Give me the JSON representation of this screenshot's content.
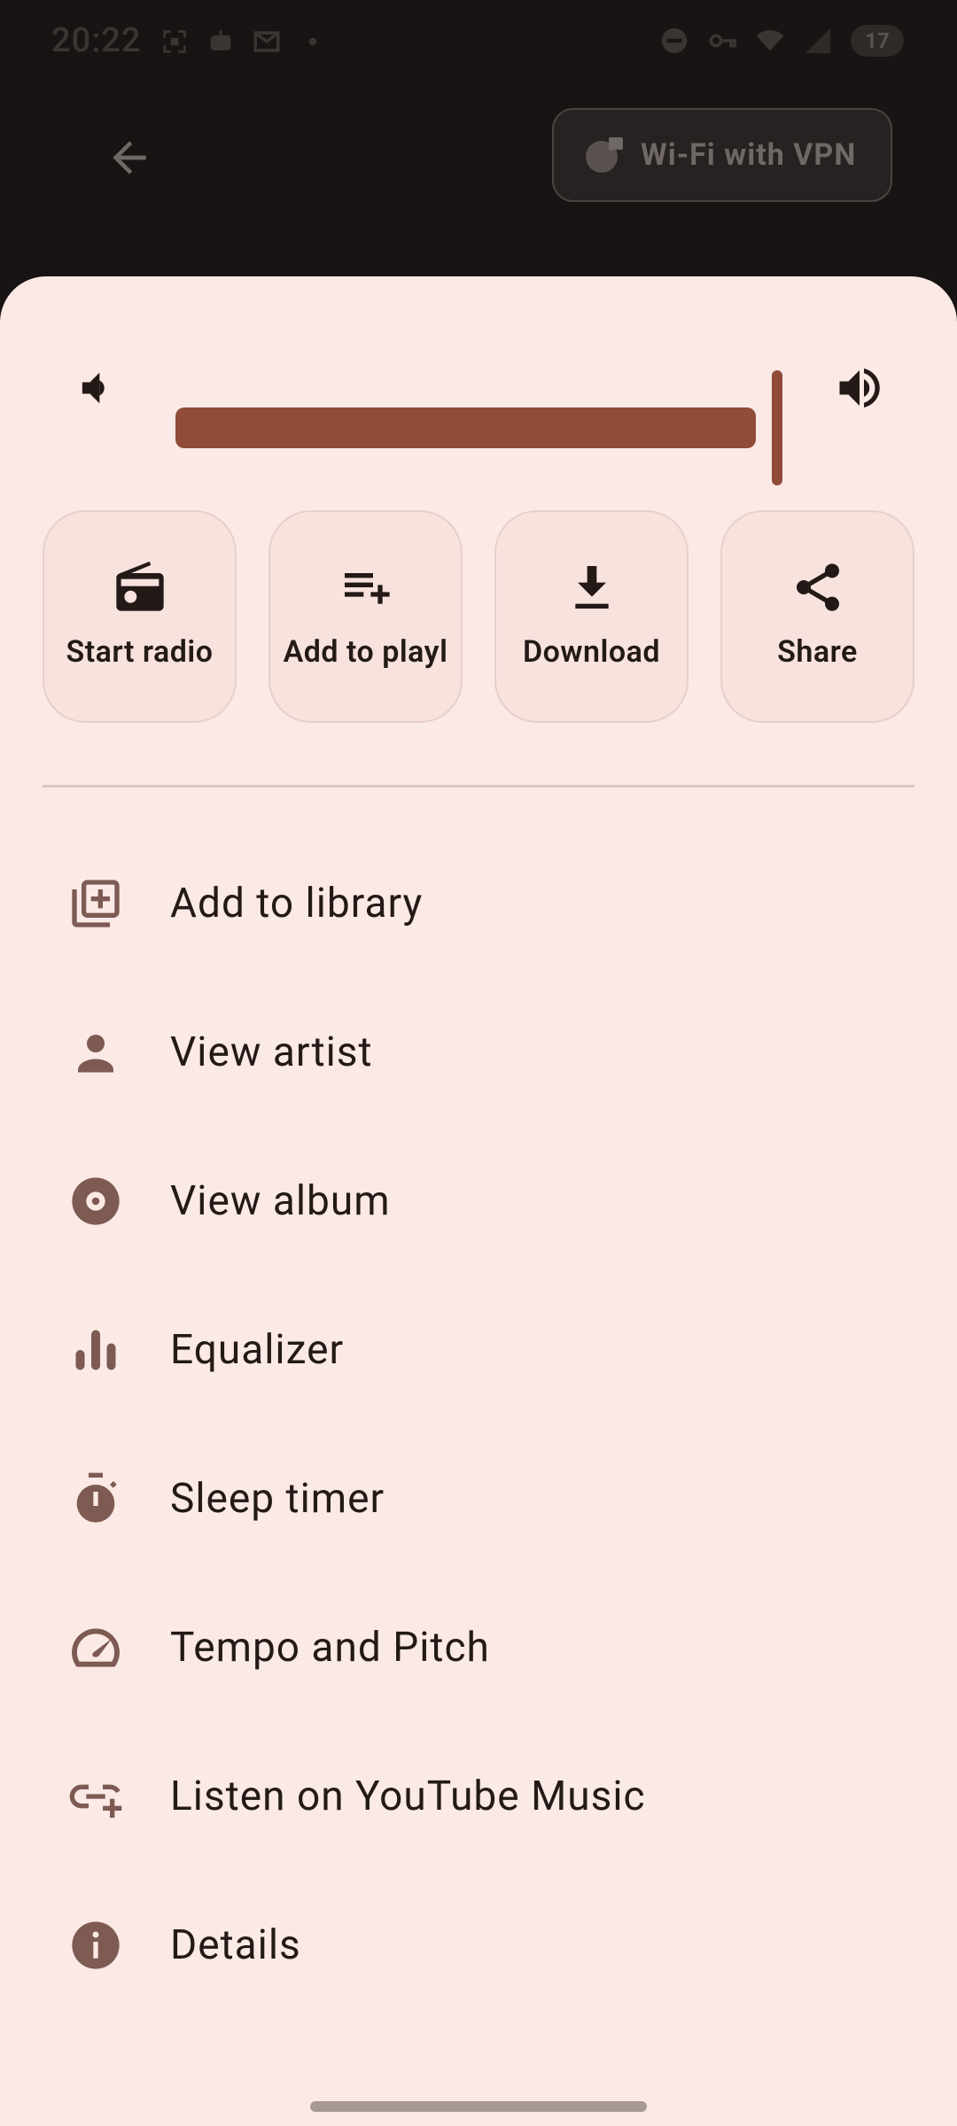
{
  "status_bar": {
    "time": "20:22",
    "battery": "17"
  },
  "header": {
    "vpn_label": "Wi-Fi with VPN"
  },
  "volume": {
    "level": 0.97
  },
  "actions": [
    {
      "label": "Start radio",
      "icon": "radio-icon"
    },
    {
      "label": "Add to playl",
      "icon": "playlist-add-icon"
    },
    {
      "label": "Download",
      "icon": "download-icon"
    },
    {
      "label": "Share",
      "icon": "share-icon"
    }
  ],
  "menu": [
    {
      "label": "Add to library",
      "icon": "library-add-icon"
    },
    {
      "label": "View artist",
      "icon": "person-icon"
    },
    {
      "label": "View album",
      "icon": "album-icon"
    },
    {
      "label": "Equalizer",
      "icon": "equalizer-icon"
    },
    {
      "label": "Sleep timer",
      "icon": "timer-icon"
    },
    {
      "label": "Tempo and Pitch",
      "icon": "speed-icon"
    },
    {
      "label": "Listen on YouTube Music",
      "icon": "link-add-icon"
    },
    {
      "label": "Details",
      "icon": "info-icon"
    }
  ],
  "colors": {
    "sheet_bg": "#fbe9e6",
    "accent": "#8f4c39",
    "icon": "#7d5a52",
    "text": "#231a18"
  }
}
